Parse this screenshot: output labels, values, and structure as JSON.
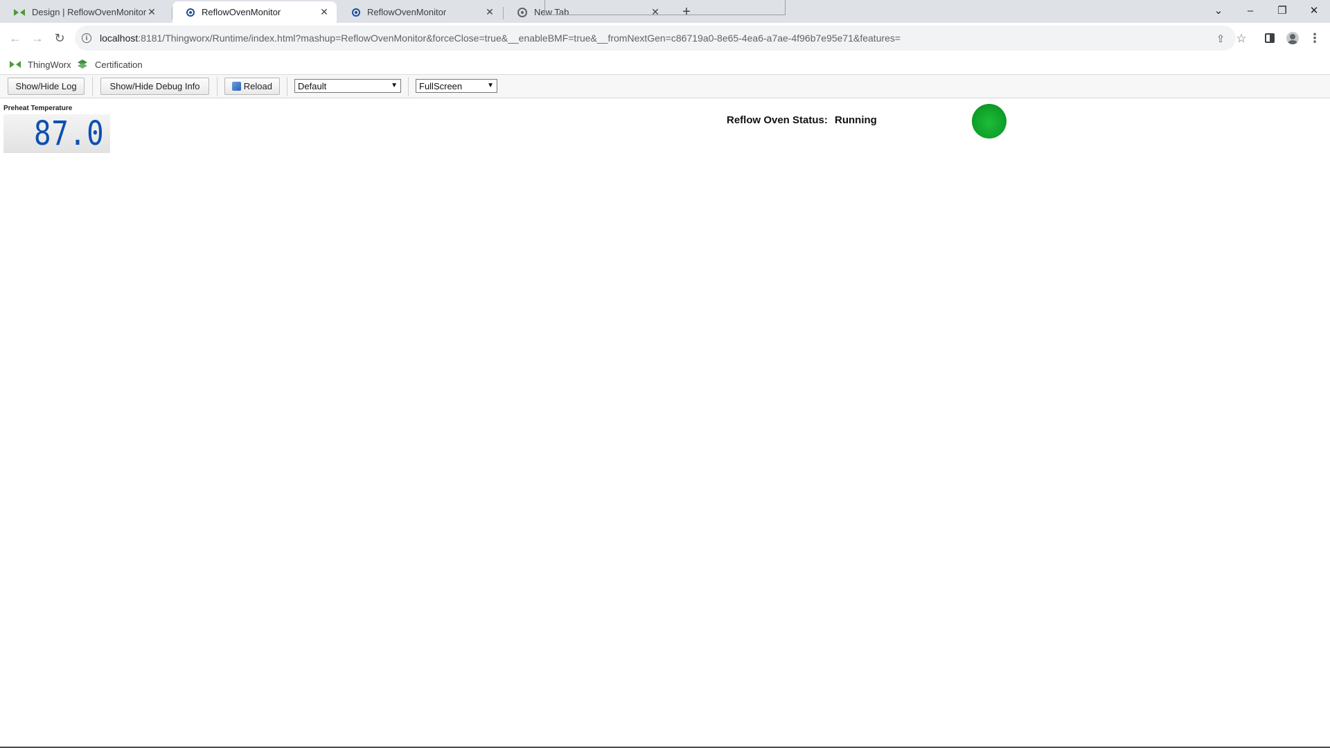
{
  "browser": {
    "tabs": [
      {
        "title": "Design | ReflowOvenMonitor",
        "favicon": "thingworx-icon",
        "active": false
      },
      {
        "title": "ReflowOvenMonitor",
        "favicon": "gear-icon",
        "active": true
      },
      {
        "title": "ReflowOvenMonitor",
        "favicon": "gear-icon",
        "active": false
      },
      {
        "title": "New Tab",
        "favicon": "chrome-icon",
        "active": false
      }
    ],
    "url_host": "localhost",
    "url_rest": ":8181/Thingworx/Runtime/index.html?mashup=ReflowOvenMonitor&forceClose=true&__enableBMF=true&__fromNextGen=c86719a0-8e65-4ea6-a7ae-4f96b7e95e71&features=",
    "bookmarks": [
      {
        "label": "ThingWorx",
        "icon": "thingworx-icon"
      },
      {
        "label": "Certification",
        "icon": "certification-icon"
      }
    ]
  },
  "mashup_toolbar": {
    "show_hide_log": "Show/Hide Log",
    "show_hide_debug": "Show/Hide Debug Info",
    "reload": "Reload",
    "theme_select": "Default",
    "view_select": "FullScreen"
  },
  "content": {
    "gauge_label": "Preheat Temperature",
    "gauge_value": "87.0",
    "status_label": "Reflow Oven Status:",
    "status_value": "Running",
    "status_led_color": "#10a02a"
  }
}
